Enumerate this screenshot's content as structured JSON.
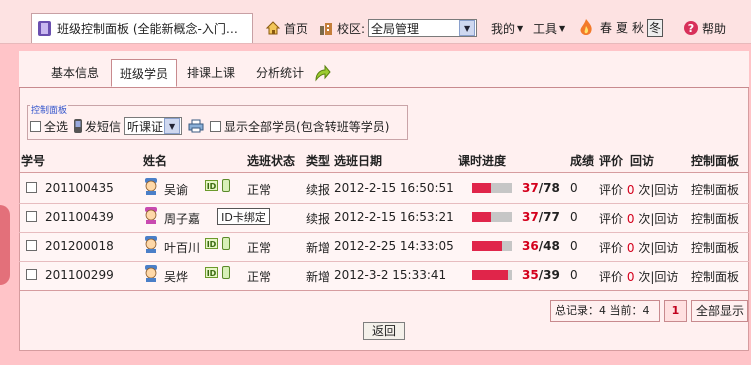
{
  "topbar": {
    "window_tab": "班级控制面板 (全能新概念-入门…",
    "home_label": "首页",
    "campus_label": "校区:",
    "campus_select": "全局管理",
    "my_label": "我的",
    "tools_label": "工具",
    "seasons": [
      "春",
      "夏",
      "秋",
      "冬"
    ],
    "help_label": "帮助"
  },
  "subtabs": [
    "基本信息",
    "班级学员",
    "排课上课",
    "分析统计"
  ],
  "control": {
    "title": "控制面板",
    "select_all": "全选",
    "sms_label": "发短信",
    "sms_select": "听课证",
    "show_all": "显示全部学员(包含转班等学员)"
  },
  "table": {
    "headers": [
      "学号",
      "姓名",
      "选班状态",
      "类型",
      "选班日期",
      "课时进度",
      "成绩",
      "评价",
      "回访",
      "控制面板"
    ],
    "rows": [
      {
        "id": "201100435",
        "name": "吴谕",
        "status": "正常",
        "type": "续报",
        "date": "2012-2-15 16:50:51",
        "done": "37",
        "total": "78",
        "progress": 0.47,
        "score": "0",
        "eval_prefix": "评价",
        "eval_count": "0",
        "eval_suffix": "次|回访",
        "panel": "控制面板",
        "avatar": "boy-avatar-icon"
      },
      {
        "id": "201100439",
        "name": "周子嘉",
        "status": "",
        "type": "续报",
        "date": "2012-2-15 16:53:21",
        "done": "37",
        "total": "77",
        "progress": 0.48,
        "score": "0",
        "eval_prefix": "评价",
        "eval_count": "0",
        "eval_suffix": "次|回访",
        "panel": "控制面板",
        "avatar": "girl-avatar-icon"
      },
      {
        "id": "201200018",
        "name": "叶百川",
        "status": "正常",
        "type": "新增",
        "date": "2012-2-25 14:33:05",
        "done": "36",
        "total": "48",
        "progress": 0.75,
        "score": "0",
        "eval_prefix": "评价",
        "eval_count": "0",
        "eval_suffix": "次|回访",
        "panel": "控制面板",
        "avatar": "boy-avatar-icon"
      },
      {
        "id": "201100299",
        "name": "吴烨",
        "status": "正常",
        "type": "新增",
        "date": "2012-3-2 15:33:41",
        "done": "35",
        "total": "39",
        "progress": 0.9,
        "score": "0",
        "eval_prefix": "评价",
        "eval_count": "0",
        "eval_suffix": "次|回访",
        "panel": "控制面板",
        "avatar": "boy-avatar-icon"
      }
    ]
  },
  "tooltip": "ID卡绑定",
  "pager": {
    "summary": "总记录：4 当前：4",
    "page": "1",
    "show_all": "全部显示"
  },
  "back_button": "返回",
  "colors": {
    "accent_red": "#d4001c",
    "bar_fill": "#e0254a",
    "background": "#ffc4c8"
  }
}
